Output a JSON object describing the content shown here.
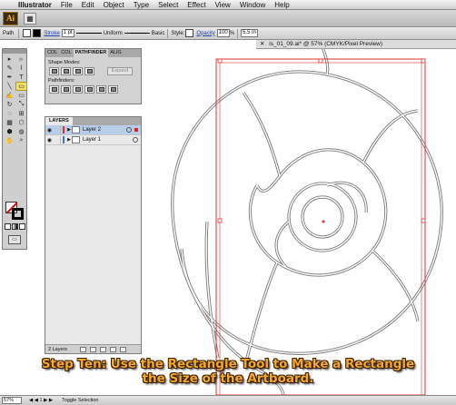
{
  "menubar": {
    "apple_symbol": "",
    "app_name": "Illustrator",
    "items": [
      "File",
      "Edit",
      "Object",
      "Type",
      "Select",
      "Effect",
      "View",
      "Window",
      "Help"
    ]
  },
  "appbar": {
    "logo_text": "Ai",
    "arrange_icon": "▦"
  },
  "controlbar": {
    "selection_label": "Path",
    "stroke_label": "Stroke",
    "stroke_weight": "1 pt",
    "profile_label": "Uniform",
    "brush_label": "Basic",
    "style_label": "Style:",
    "opacity_label": "Opacity",
    "opacity_value": "100",
    "opacity_unit": "%",
    "width_value": "5.5 in"
  },
  "document_tab": {
    "close_symbol": "✕",
    "title": "is_01_09.ai* @ 57% (CMYK/Pixel Preview)"
  },
  "tools": {
    "icons": [
      "▸",
      "▹",
      "✎",
      "⌇",
      "✒",
      "T",
      "╲",
      "▭",
      "✍",
      "▭",
      "↻",
      "⤡",
      "◌",
      "⊞",
      "▦",
      "⬡",
      "⬢",
      "◍",
      "✋",
      "⌕"
    ]
  },
  "pathfinder": {
    "tabs": [
      "COL",
      "COL",
      "PATHFINDER",
      "ALIG"
    ],
    "shape_modes_label": "Shape Modes:",
    "expand_label": "Expand",
    "pathfinders_label": "Pathfinders:"
  },
  "layers": {
    "tab_label": "LAYERS",
    "rows": [
      {
        "name": "Layer 2",
        "color": "#e0332f",
        "selected": true
      },
      {
        "name": "Layer 1",
        "color": "#4a6fd6",
        "selected": false
      }
    ],
    "footer_label": "2 Layers"
  },
  "statusbar": {
    "zoom": "57%",
    "page": "1",
    "status": "Toggle Selection"
  },
  "caption": {
    "line1": "Step Ten:  Use the Rectangle Tool to Make a Rectangle",
    "line2": "the Size of the Artboard."
  },
  "colors": {
    "selection_red": "#e0332f",
    "path_gray": "#888888",
    "caption_orange": "#f1a92a"
  }
}
